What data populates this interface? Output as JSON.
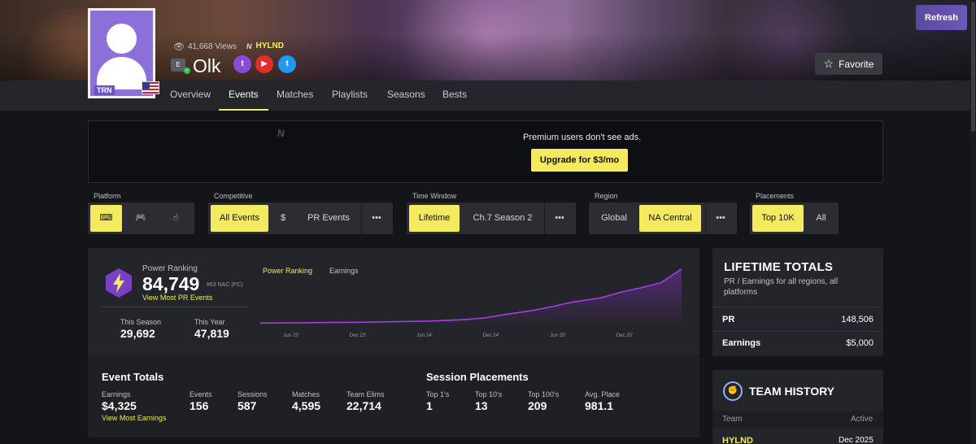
{
  "header": {
    "refresh_label": "Refresh",
    "views": "41,668 Views",
    "team": "HYLND",
    "username": "Olk",
    "favorite_label": "Favorite",
    "avatar_badge": "TRN"
  },
  "nav": {
    "tabs": [
      "Overview",
      "Events",
      "Matches",
      "Playlists",
      "Seasons",
      "Bests"
    ],
    "active": "Events"
  },
  "ad": {
    "message": "Premium users don't see ads.",
    "upgrade_label": "Upgrade for $3/mo"
  },
  "filters": {
    "platform": {
      "label": "Platform",
      "icons": [
        "keyboard-icon",
        "gamepad-icon",
        "touch-icon"
      ]
    },
    "competitive": {
      "label": "Competitive",
      "options": [
        "All Events",
        "$",
        "PR Events",
        "•••"
      ],
      "selected": "All Events"
    },
    "time_window": {
      "label": "Time Window",
      "options": [
        "Lifetime",
        "Ch.7 Season 2",
        "•••"
      ],
      "selected": "Lifetime"
    },
    "region": {
      "label": "Region",
      "options": [
        "Global",
        "NA Central",
        "•••"
      ],
      "selected": "NA Central"
    },
    "placements": {
      "label": "Placements",
      "options": [
        "Top 10K",
        "All"
      ],
      "selected": "Top 10K"
    }
  },
  "power_ranking": {
    "label": "Power Ranking",
    "value": "84,749",
    "rank": "#63 NAC (PC)",
    "link": "View Most PR Events",
    "this_season_label": "This Season",
    "this_season": "29,692",
    "this_year_label": "This Year",
    "this_year": "47,819",
    "chart_tabs": [
      "Power Ranking",
      "Earnings"
    ]
  },
  "chart_data": {
    "type": "area",
    "title": "",
    "x_ticks": [
      "Jun 23'",
      "Dec 23'",
      "Jun 24'",
      "Dec 24'",
      "Jun 25'",
      "Dec 25'"
    ],
    "x": [
      0,
      0.5,
      1,
      1.5,
      2,
      2.5,
      3,
      3.3,
      3.6,
      4,
      4.3,
      4.6,
      5,
      5.3,
      5.6,
      5.9,
      6.2
    ],
    "values": [
      1,
      1.5,
      2,
      2.5,
      3.5,
      4.5,
      7,
      10,
      16,
      23,
      30,
      38,
      45,
      55,
      63,
      72,
      96
    ],
    "ylim": [
      0,
      100
    ],
    "color": "#a73fe0",
    "grid": false
  },
  "event_totals": {
    "title": "Event Totals",
    "stats": [
      {
        "label": "Earnings",
        "value": "$4,325"
      },
      {
        "label": "Events",
        "value": "156"
      },
      {
        "label": "Sessions",
        "value": "587"
      },
      {
        "label": "Matches",
        "value": "4,595"
      },
      {
        "label": "Team Elims",
        "value": "22,714"
      }
    ],
    "earnings_link": "View Most Earnings"
  },
  "session_placements": {
    "title": "Session Placements",
    "stats": [
      {
        "label": "Top 1's",
        "value": "1"
      },
      {
        "label": "Top 10's",
        "value": "13"
      },
      {
        "label": "Top 100's",
        "value": "209"
      },
      {
        "label": "Avg. Place",
        "value": "981.1"
      }
    ]
  },
  "lifetime": {
    "title": "LIFETIME TOTALS",
    "subtitle": "PR / Earnings for all regions, all platforms",
    "rows": [
      {
        "label": "PR",
        "value": "148,506"
      },
      {
        "label": "Earnings",
        "value": "$5,000"
      }
    ]
  },
  "team_history": {
    "title": "TEAM HISTORY",
    "col_team": "Team",
    "col_active": "Active",
    "rows": [
      {
        "team": "HYLND",
        "active": "Dec 2025"
      }
    ]
  },
  "colors": {
    "accent": "#f3ea5f",
    "chart": "#a73fe0",
    "bg": "#131519",
    "panel": "#23252a"
  }
}
